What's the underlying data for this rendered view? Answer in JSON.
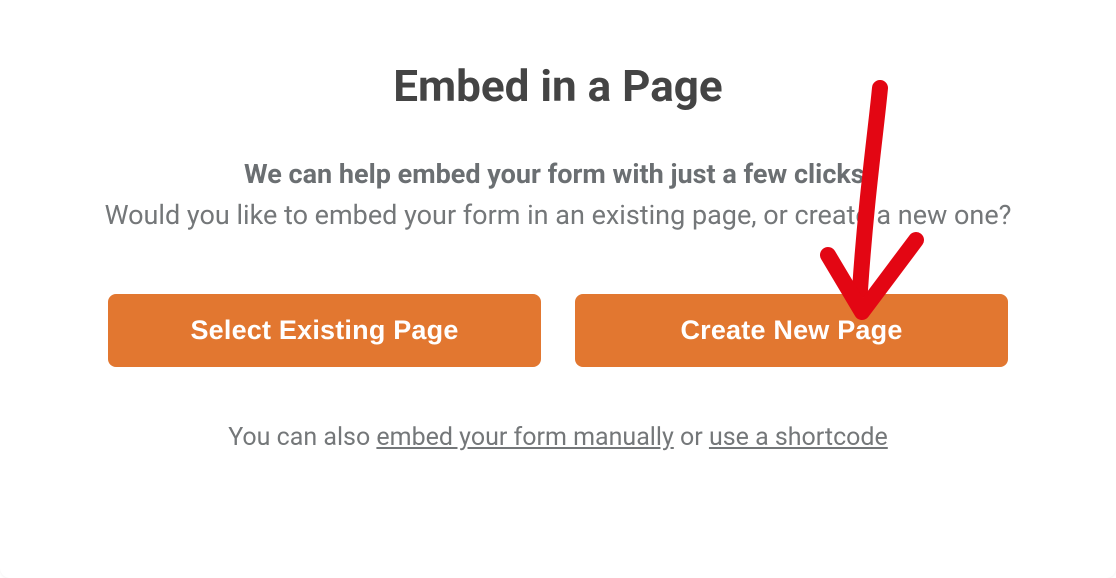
{
  "modal": {
    "title": "Embed in a Page",
    "subtitle_bold": "We can help embed your form with just a few clicks!",
    "subtitle_regular": "Would you like to embed your form in an existing page, or create a new one?",
    "buttons": {
      "select_existing": "Select Existing Page",
      "create_new": "Create New Page"
    },
    "footer": {
      "prefix": "You can also ",
      "link_manual": "embed your form manually",
      "middle": " or ",
      "link_shortcode": "use a shortcode"
    }
  }
}
